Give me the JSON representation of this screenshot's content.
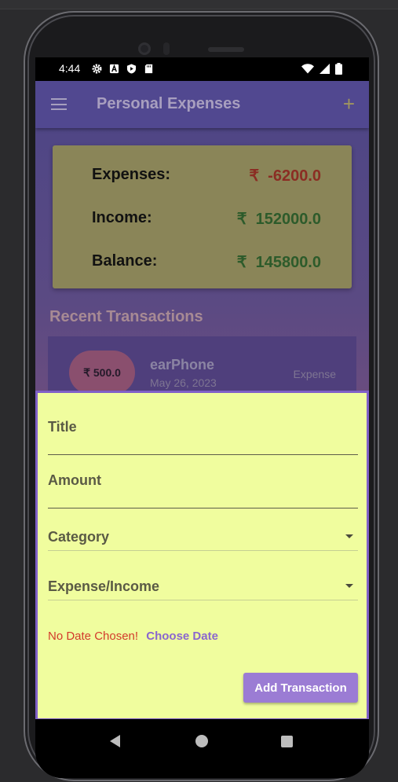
{
  "status_bar": {
    "time": "4:44",
    "left_icons": [
      "gear-icon",
      "a-icon",
      "shield-play-icon",
      "sd-card-icon"
    ],
    "right_icons": [
      "wifi-icon",
      "signal-icon",
      "battery-icon"
    ]
  },
  "app_bar": {
    "title": "Personal Expenses",
    "menu_icon": "menu-icon",
    "add_icon": "plus-icon",
    "add_symbol": "+"
  },
  "summary": {
    "expenses_label": "Expenses:",
    "expenses_value": "₹  -6200.0",
    "income_label": "Income:",
    "income_value": "₹  152000.0",
    "balance_label": "Balance:",
    "balance_value": "₹  145800.0"
  },
  "recent": {
    "title": "Recent Transactions",
    "items": [
      {
        "amount": "₹ 500.0",
        "title": "earPhone",
        "date": "May 26, 2023",
        "type": "Expense"
      }
    ]
  },
  "form": {
    "title_placeholder": "Title",
    "amount_placeholder": "Amount",
    "category_label": "Category",
    "type_label": "Expense/Income",
    "no_date_text": "No Date Chosen!",
    "choose_date_label": "Choose Date",
    "submit_label": "Add Transaction"
  },
  "colors": {
    "expense_red": "#8b2d23",
    "income_green": "#2d5b2b",
    "sheet_bg": "#f0fd9e",
    "accent_purple": "#9b7cd4"
  }
}
